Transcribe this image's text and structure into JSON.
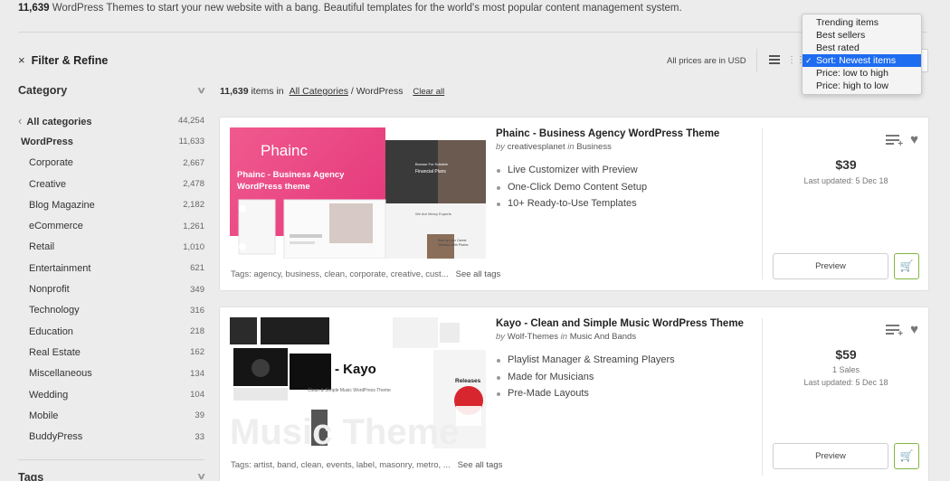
{
  "header": {
    "count_bold": "11,639",
    "tagline_rest": "WordPress Themes to start your new website with a bang.  Beautiful templates for the world's most popular content management system."
  },
  "filter": {
    "close_symbol": "×",
    "title": "Filter & Refine"
  },
  "sidebar": {
    "category_title": "Category",
    "tags_title": "Tags",
    "items": [
      {
        "label": "All categories",
        "count": "44,254"
      },
      {
        "label": "WordPress",
        "count": "11,633"
      },
      {
        "label": "Corporate",
        "count": "2,667"
      },
      {
        "label": "Creative",
        "count": "2,478"
      },
      {
        "label": "Blog Magazine",
        "count": "2,182"
      },
      {
        "label": "eCommerce",
        "count": "1,261"
      },
      {
        "label": "Retail",
        "count": "1,010"
      },
      {
        "label": "Entertainment",
        "count": "621"
      },
      {
        "label": "Nonprofit",
        "count": "349"
      },
      {
        "label": "Technology",
        "count": "316"
      },
      {
        "label": "Education",
        "count": "218"
      },
      {
        "label": "Real Estate",
        "count": "162"
      },
      {
        "label": "Miscellaneous",
        "count": "134"
      },
      {
        "label": "Wedding",
        "count": "104"
      },
      {
        "label": "Mobile",
        "count": "39"
      },
      {
        "label": "BuddyPress",
        "count": "33"
      }
    ]
  },
  "results": {
    "count": "11,639",
    "items_in": "items in",
    "all_categories": "All Categories",
    "path_rest": "/ WordPress",
    "clear_all": "Clear all"
  },
  "toolbar": {
    "usd_note": "All prices are in USD",
    "grid_glyph": "⋮⋮⋮"
  },
  "sort_menu": {
    "check": "✓",
    "options": [
      "Trending items",
      "Best sellers",
      "Best rated",
      "Sort: Newest items",
      "Price: low to high",
      "Price: high to low"
    ],
    "selected_index": 3
  },
  "products": [
    {
      "title": "Phainc - Business Agency WordPress Theme",
      "by": "by",
      "author": "creativesplanet",
      "in": "in",
      "category": "Business",
      "features": [
        "Live Customizer with Preview",
        "One-Click Demo Content Setup",
        "10+ Ready-to-Use Templates"
      ],
      "price": "$39",
      "sales": "",
      "updated": "Last updated: 5 Dec 18",
      "tags": "Tags: agency, business, clean, corporate, creative, cust...",
      "see_all": "See all tags",
      "preview": "Preview",
      "thumb": {
        "brand": "Phainc",
        "headline": "Phainc - Business Agency",
        "sub": "WordPress theme",
        "c1": "Browse For Suitable",
        "c2": "Financial Plans",
        "c3": "We Are Mercy Experts",
        "c4": "Start up your Career",
        "c5": "Ventures With Phainc"
      }
    },
    {
      "title": "Kayo - Clean and Simple Music WordPress Theme",
      "by": "by",
      "author": "Wolf-Themes",
      "in": "in",
      "category": "Music And Bands",
      "features": [
        "Playlist Manager & Streaming Players",
        "Made for Musicians",
        "Pre-Made Layouts"
      ],
      "price": "$59",
      "sales": "1 Sales",
      "updated": "Last updated: 5 Dec 18",
      "tags": "Tags: artist, band, clean, events, label, masonry, metro, ...",
      "see_all": "See all tags",
      "preview": "Preview",
      "thumb": {
        "brand": "- Kayo",
        "sub": "Clean & Simple Music WordPress Theme",
        "releases": "Releases",
        "music": "Music Theme"
      }
    }
  ],
  "colors": {
    "accent_green": "#82b541",
    "select_blue": "#1e6cf0",
    "phainc_pink": "#ee4a86"
  }
}
